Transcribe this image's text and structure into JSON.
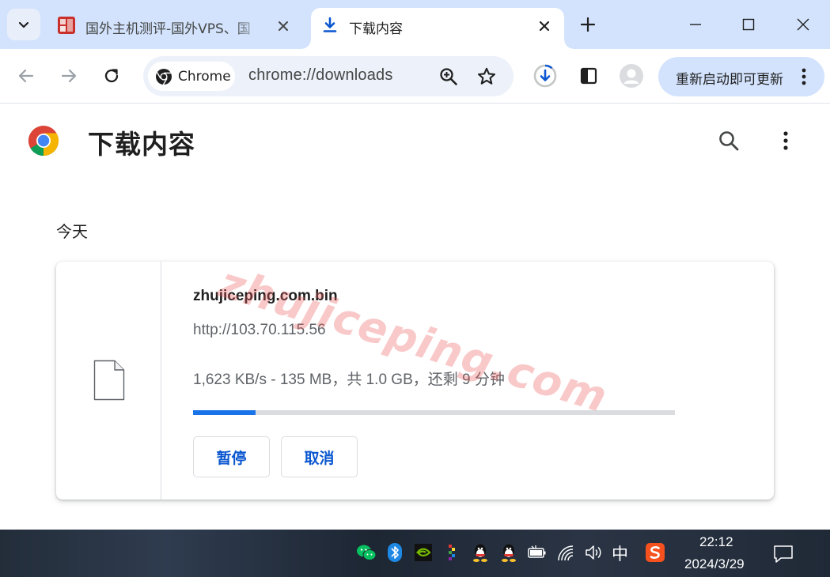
{
  "browser": {
    "tabs": [
      {
        "title": "国外主机测评-国外VPS、国",
        "favicon": "site-favicon",
        "active": false
      },
      {
        "title": "下载内容",
        "favicon": "download-icon",
        "active": true
      }
    ],
    "toolbar": {
      "chip_label": "Chrome",
      "url": "chrome://downloads",
      "update_label": "重新启动即可更新"
    },
    "colors": {
      "tabstrip": "#d3e3fd",
      "accent": "#1a73e8",
      "omnibox": "#edf2fa"
    }
  },
  "page": {
    "title": "下载内容",
    "date_heading": "今天",
    "watermark": "zhujiceping.com"
  },
  "download": {
    "file_name": "zhujiceping.com.bin",
    "source_url": "http://103.70.115.56",
    "status": "1,623 KB/s - 135 MB，共 1.0 GB，还剩 9 分钟",
    "progress": 0.13,
    "pause_label": "暂停",
    "cancel_label": "取消"
  },
  "taskbar": {
    "tray_icons": [
      "wechat-icon",
      "bluetooth-icon",
      "nvidia-icon",
      "app-icon",
      "qq-icon",
      "qq-icon",
      "battery-icon",
      "wifi-icon",
      "volume-icon",
      "sogou-icon"
    ],
    "ime": "中",
    "time": "22:12",
    "date": "2024/3/29"
  }
}
